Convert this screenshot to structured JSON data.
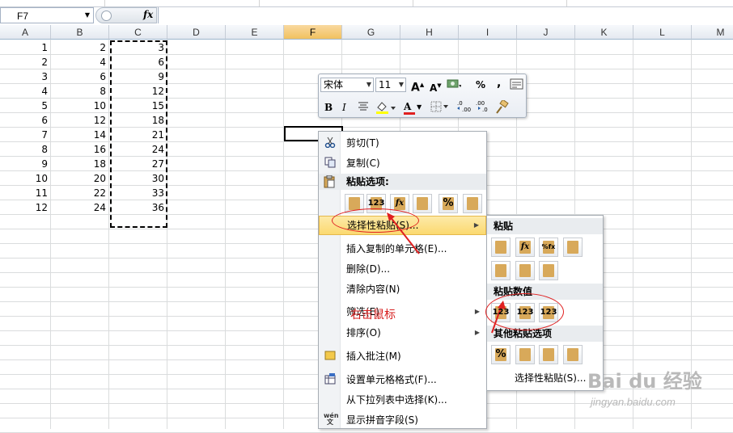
{
  "name_box": {
    "value": "F7"
  },
  "formula_bar": {
    "fx_label": "fx",
    "value": ""
  },
  "columns": [
    "A",
    "B",
    "C",
    "D",
    "E",
    "F",
    "G",
    "H",
    "I",
    "J",
    "K",
    "L",
    "M"
  ],
  "selected_column": "F",
  "rows": [
    {
      "a": "1",
      "b": "2",
      "c": "3"
    },
    {
      "a": "2",
      "b": "4",
      "c": "6"
    },
    {
      "a": "3",
      "b": "6",
      "c": "9"
    },
    {
      "a": "4",
      "b": "8",
      "c": "12"
    },
    {
      "a": "5",
      "b": "10",
      "c": "15"
    },
    {
      "a": "6",
      "b": "12",
      "c": "18"
    },
    {
      "a": "7",
      "b": "14",
      "c": "21"
    },
    {
      "a": "8",
      "b": "16",
      "c": "24"
    },
    {
      "a": "9",
      "b": "18",
      "c": "27"
    },
    {
      "a": "10",
      "b": "20",
      "c": "30"
    },
    {
      "a": "11",
      "b": "22",
      "c": "33"
    },
    {
      "a": "12",
      "b": "24",
      "c": "36"
    }
  ],
  "mini_toolbar": {
    "font_name": "宋体",
    "font_size": "11",
    "grow_font": "A",
    "shrink_font": "A",
    "percent": "%",
    "comma": ",",
    "bold": "B",
    "italic": "I",
    "font_color_letter": "A",
    "inc_decimal": ".0 .00",
    "dec_decimal": ".00 .0"
  },
  "context_menu": {
    "cut": "剪切(T)",
    "copy": "复制(C)",
    "paste_options_header": "粘贴选项:",
    "paste_special": "选择性粘贴(S)...",
    "insert_copied": "插入复制的单元格(E)...",
    "delete": "删除(D)...",
    "clear_contents": "清除内容(N)",
    "filter": "筛选(E)",
    "sort": "排序(O)",
    "insert_comment": "插入批注(M)",
    "format_cells": "设置单元格格式(F)...",
    "pick_from_list": "从下拉列表中选择(K)...",
    "show_phonetic": "显示拼音字段(S)",
    "phonetic_icon_label": "wén 文",
    "paste_icon_labels": [
      "",
      "123",
      "fx",
      "",
      "%",
      ""
    ]
  },
  "submenu": {
    "paste_header": "粘贴",
    "paste_values_header": "粘贴数值",
    "other_paste_header": "其他粘贴选项",
    "paste_special_item": "选择性粘贴(S)...",
    "value_icon_labels": [
      "123",
      "123",
      "123"
    ],
    "paste_icon_labels": [
      "",
      "fx",
      "%fx",
      ""
    ],
    "other_icon_labels": [
      "%",
      "",
      "",
      ""
    ]
  },
  "annotations": {
    "right_click_label": "右击鼠标"
  },
  "watermark": {
    "brand": "Bai du 经验",
    "url": "jingyan.baidu.com"
  },
  "colors": {
    "accent_red": "#e02020",
    "header_selected": "#f1c15f",
    "menu_highlight": "#fbd970"
  }
}
